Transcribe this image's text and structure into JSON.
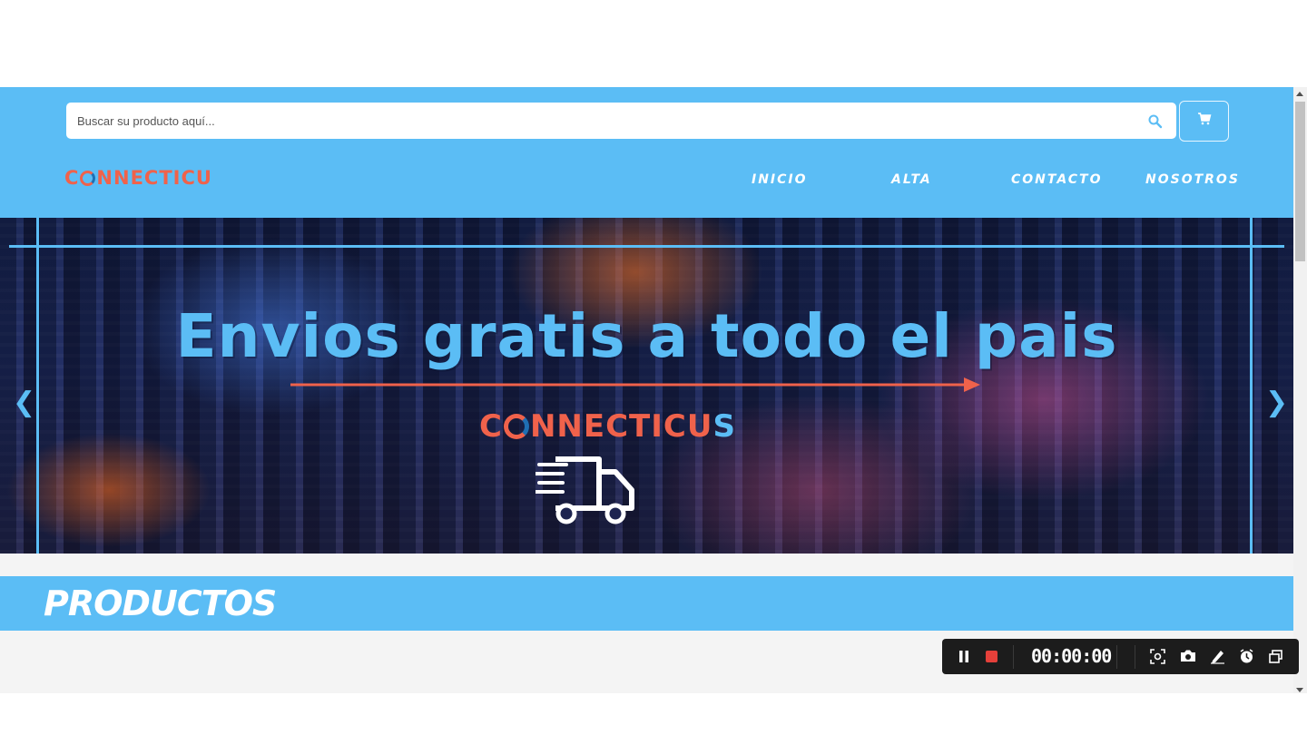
{
  "search": {
    "placeholder": "Buscar su producto aquí..."
  },
  "brand": {
    "logo_text_pre": "C",
    "logo_text_post": "NNECTICU"
  },
  "nav": [
    {
      "label": "INICIO"
    },
    {
      "label": "ALTA"
    },
    {
      "label": "CONTACTO"
    },
    {
      "label": "NOSOTROS"
    }
  ],
  "banner": {
    "headline": "Envios gratis a todo el pais",
    "logo_pre": "C",
    "logo_mid": "NNECTICU",
    "logo_end": "S",
    "prev_arrow": "❮",
    "next_arrow": "❯"
  },
  "section": {
    "title": "PRODUCTOS"
  },
  "recorder": {
    "timer": "00:00:00"
  },
  "colors": {
    "primary": "#5bbdf5",
    "accent": "#f0624b",
    "white": "#ffffff"
  },
  "icons": [
    "search-icon",
    "cart-icon",
    "truck-icon",
    "pause-icon",
    "stop-icon",
    "region-icon",
    "camera-icon",
    "pen-icon",
    "clock-icon",
    "window-icon"
  ]
}
